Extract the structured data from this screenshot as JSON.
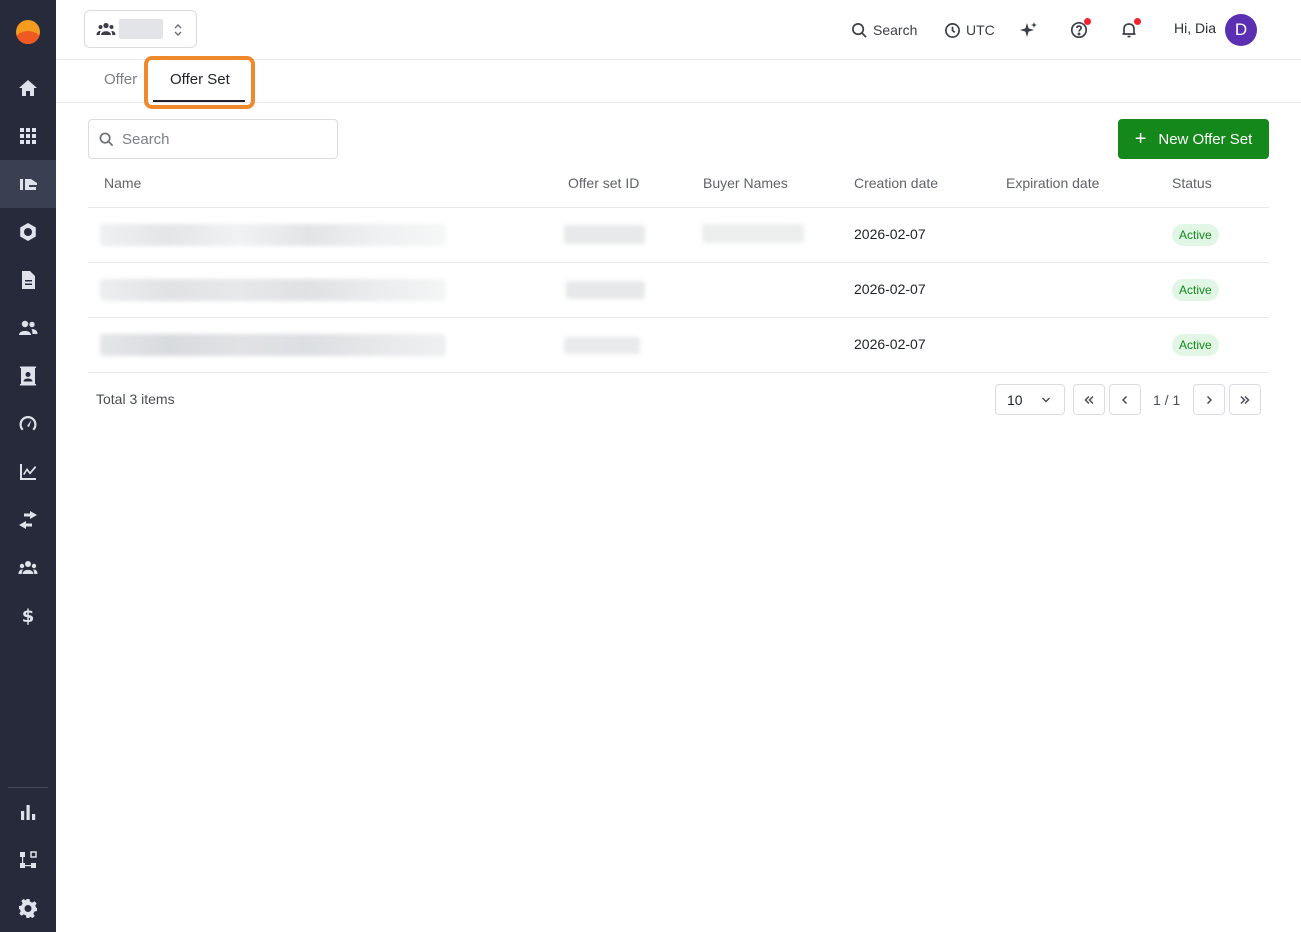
{
  "sidebar": {
    "items": [
      {
        "name": "home-icon"
      },
      {
        "name": "apps-grid-icon"
      },
      {
        "name": "offers-icon",
        "active": true
      },
      {
        "name": "settings-gear-icon"
      },
      {
        "name": "document-icon"
      },
      {
        "name": "users-icon"
      },
      {
        "name": "contacts-icon"
      },
      {
        "name": "dashboard-gauge-icon"
      },
      {
        "name": "analytics-icon"
      },
      {
        "name": "transfer-icon"
      },
      {
        "name": "groups-icon"
      },
      {
        "name": "dollar-icon"
      }
    ],
    "bottom_items": [
      {
        "name": "bar-chart-icon"
      },
      {
        "name": "workflow-icon"
      },
      {
        "name": "settings-cog-icon"
      }
    ]
  },
  "header": {
    "search_label": "Search",
    "timezone_label": "UTC",
    "greeting": "Hi, Dia",
    "avatar_initial": "D"
  },
  "tabs": [
    {
      "label": "Offer"
    },
    {
      "label": "Offer Set",
      "active": true
    }
  ],
  "toolbar": {
    "search_placeholder": "Search",
    "new_button_label": "New Offer Set"
  },
  "table": {
    "columns": [
      "Name",
      "Offer set ID",
      "Buyer Names",
      "Creation date",
      "Expiration date",
      "Status"
    ],
    "rows": [
      {
        "creation_date": "2026-02-07",
        "expiration_date": "",
        "status": "Active"
      },
      {
        "creation_date": "2026-02-07",
        "expiration_date": "",
        "status": "Active"
      },
      {
        "creation_date": "2026-02-07",
        "expiration_date": "",
        "status": "Active"
      }
    ]
  },
  "pagination": {
    "total_label": "Total 3 items",
    "page_size": "10",
    "page_indicator": "1 / 1"
  },
  "colors": {
    "sidebar_bg": "#262a3b",
    "primary_green": "#15881b",
    "highlight_orange": "#ef8a2c",
    "avatar_purple": "#5b2fb1",
    "notification_red": "#f5222d"
  }
}
